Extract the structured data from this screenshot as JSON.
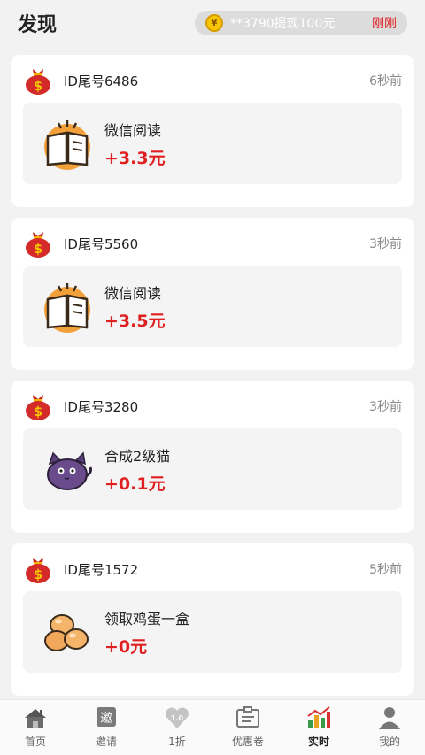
{
  "header": {
    "title": "发现",
    "ticker_coin": "¥",
    "ticker_text": "**3790提现100元",
    "ticker_time": "刚刚"
  },
  "feed": [
    {
      "user": "ID尾号6486",
      "time": "6秒前",
      "task": "微信阅读",
      "amount": "+3.3元",
      "icon": "book-icon"
    },
    {
      "user": "ID尾号5560",
      "time": "3秒前",
      "task": "微信阅读",
      "amount": "+3.5元",
      "icon": "book-icon"
    },
    {
      "user": "ID尾号3280",
      "time": "3秒前",
      "task": "合成2级猫",
      "amount": "+0.1元",
      "icon": "cat-icon"
    },
    {
      "user": "ID尾号1572",
      "time": "5秒前",
      "task": "领取鸡蛋一盒",
      "amount": "+0元",
      "icon": "eggs-icon"
    }
  ],
  "tabbar": [
    {
      "label": "首页",
      "icon": "home-icon"
    },
    {
      "label": "邀请",
      "icon": "invite-icon",
      "glyph": "邀"
    },
    {
      "label": "1折",
      "icon": "discount-heart-icon",
      "glyph": "1.0"
    },
    {
      "label": "优惠卷",
      "icon": "coupon-icon"
    },
    {
      "label": "实时",
      "icon": "realtime-chart-icon",
      "active": true
    },
    {
      "label": "我的",
      "icon": "profile-icon"
    }
  ],
  "colors": {
    "accent_red": "#e02020",
    "background": "#f2f2f2"
  }
}
